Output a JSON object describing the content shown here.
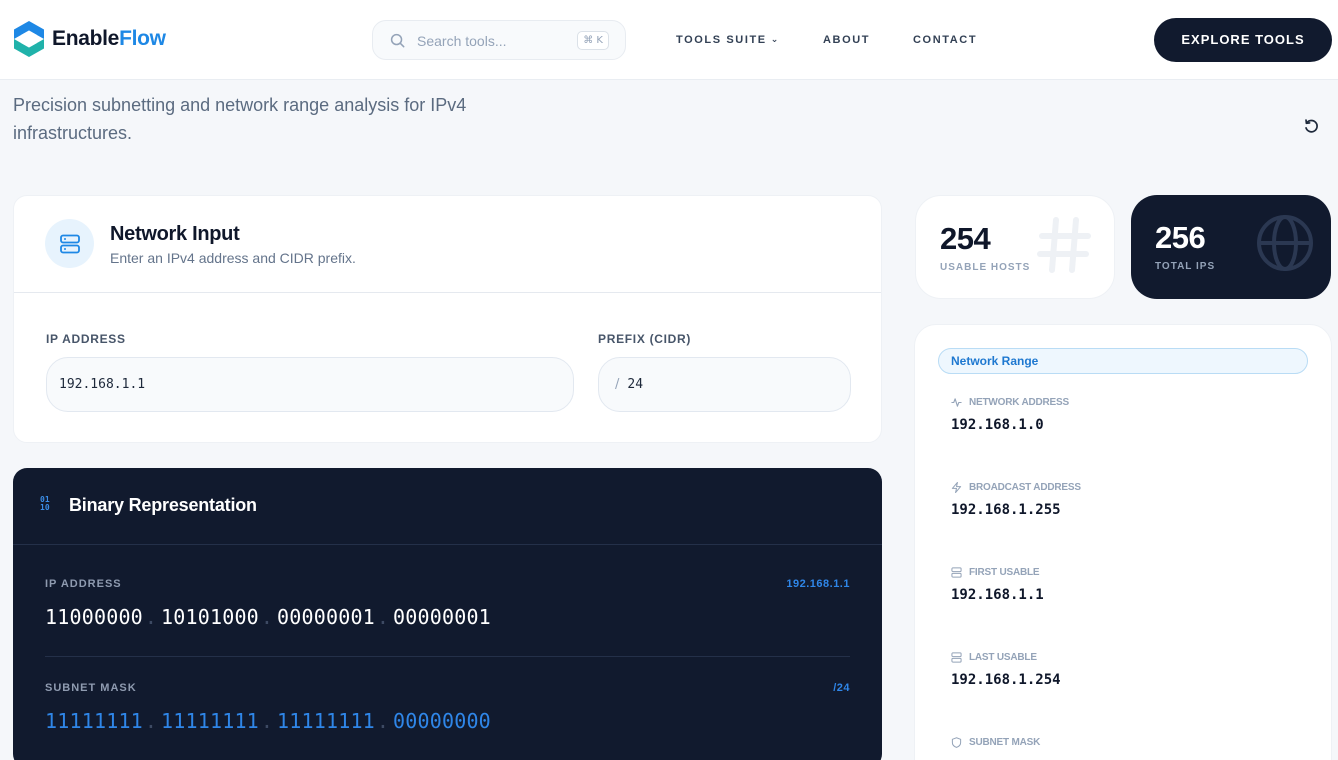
{
  "brand": {
    "name_part1": "Enable",
    "name_part2": "Flow"
  },
  "search": {
    "placeholder": "Search tools...",
    "shortcut": "⌘ K"
  },
  "nav": {
    "tools_suite": "TOOLS SUITE",
    "about": "ABOUT",
    "contact": "CONTACT",
    "cta": "EXPLORE TOOLS"
  },
  "intro": {
    "text": "Precision subnetting and network range analysis for IPv4 infrastructures."
  },
  "network_input": {
    "title": "Network Input",
    "subtitle": "Enter an IPv4 address and CIDR prefix.",
    "ip_label": "IP ADDRESS",
    "ip_value": "192.168.1.1",
    "prefix_label": "PREFIX (CIDR)",
    "prefix_slash": "/",
    "prefix_value": "24"
  },
  "binary": {
    "title": "Binary Representation",
    "ip_label": "IP ADDRESS",
    "ip_tag": "192.168.1.1",
    "ip_octets": [
      "11000000",
      "10101000",
      "00000001",
      "00000001"
    ],
    "mask_label": "SUBNET MASK",
    "mask_tag": "/24",
    "mask_octets": [
      "11111111",
      "11111111",
      "11111111",
      "00000000"
    ],
    "separator": "."
  },
  "stats": {
    "usable_hosts": {
      "value": "254",
      "label": "USABLE HOSTS"
    },
    "total_ips": {
      "value": "256",
      "label": "TOTAL IPS"
    }
  },
  "range": {
    "pill": "Network Range",
    "items": [
      {
        "label": "NETWORK ADDRESS",
        "value": "192.168.1.0",
        "icon": "activity-icon"
      },
      {
        "label": "BROADCAST ADDRESS",
        "value": "192.168.1.255",
        "icon": "zap-icon"
      },
      {
        "label": "FIRST USABLE",
        "value": "192.168.1.1",
        "icon": "server-icon"
      },
      {
        "label": "LAST USABLE",
        "value": "192.168.1.254",
        "icon": "server-icon"
      },
      {
        "label": "SUBNET MASK",
        "value": "",
        "icon": "shield-icon"
      }
    ]
  },
  "colors": {
    "accent": "#1e88e5",
    "dark": "#111a2e",
    "background": "#f5f7fa"
  }
}
